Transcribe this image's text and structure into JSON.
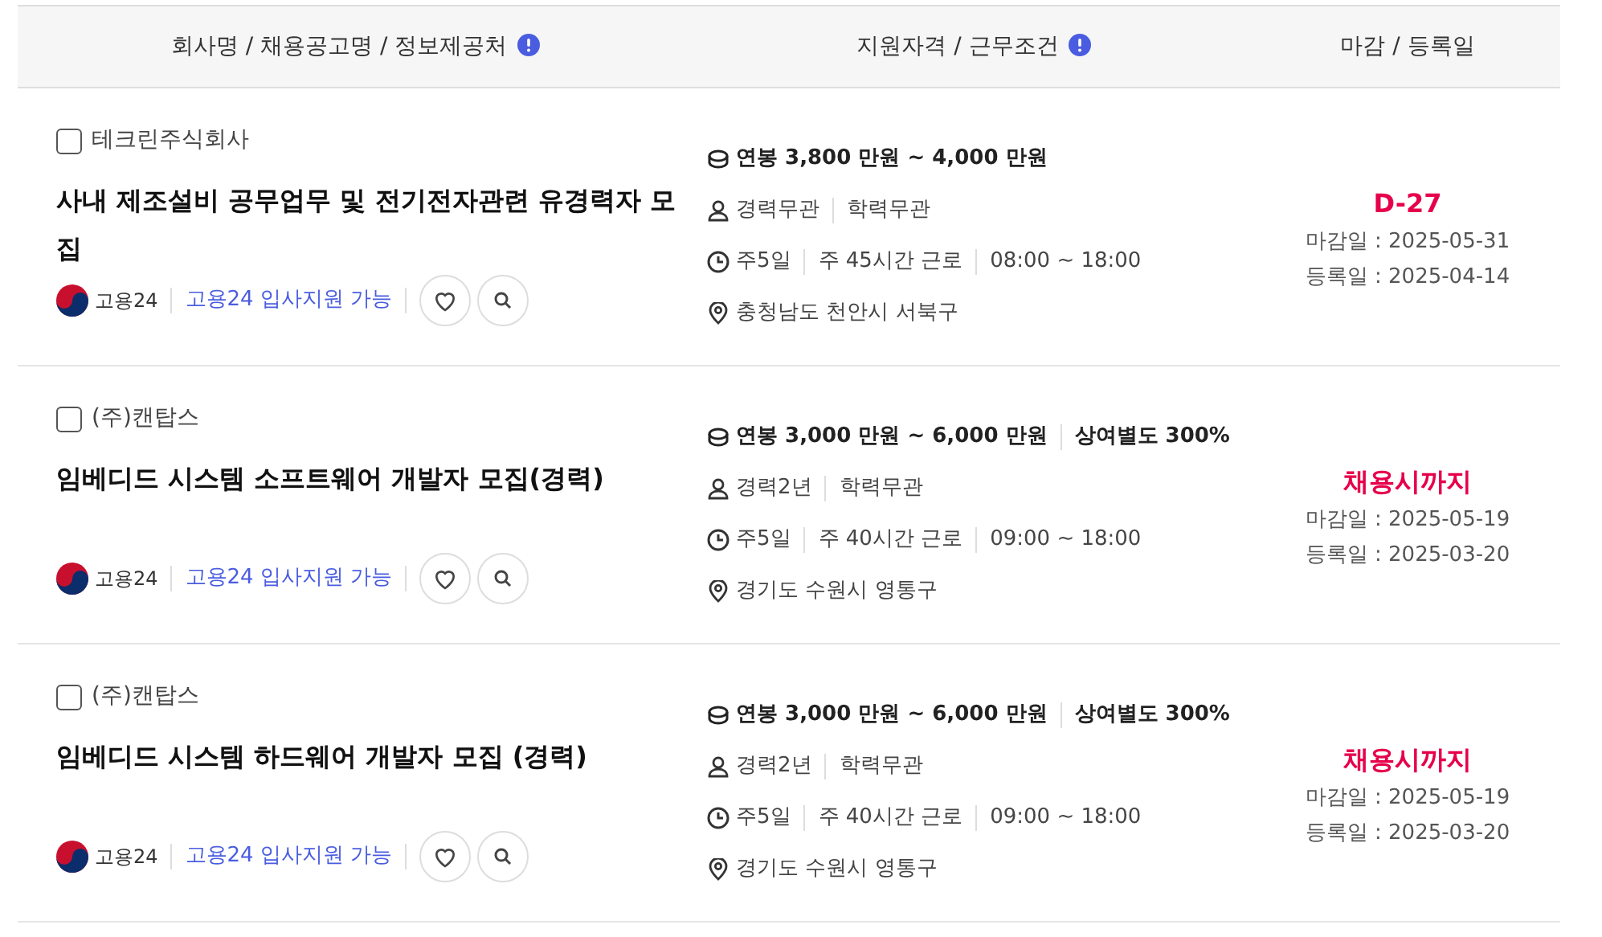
{
  "header": {
    "columns": [
      {
        "label": "회사명 / 채용공고명 / 정보제공처",
        "info": true
      },
      {
        "label": "지원자격 / 근무조건",
        "info": true
      },
      {
        "label": "마감 / 등록일",
        "info": false
      }
    ]
  },
  "jobs": [
    {
      "checked": false,
      "company": "테크린주식회사",
      "title": "사내 제조설비 공무업무 및 전기전자관련 유경력자 모집",
      "source": "고용24",
      "badge": "고용24 입사지원 가능",
      "favorite": false,
      "salary": [
        "연봉 3,800 만원 ~ 4,000 만원"
      ],
      "career": [
        "경력무관",
        "학력무관"
      ],
      "work": [
        "주5일",
        "주 45시간 근로",
        "08:00 ~ 18:00"
      ],
      "location": "충청남도 천안시 서북구",
      "deadline": "D-27",
      "deadline_date": "마감일 : 2025-05-31",
      "registered": "등록일 : 2025-04-14"
    },
    {
      "checked": false,
      "company": "(주)캔탑스",
      "title": "임베디드 시스템 소프트웨어 개발자 모집(경력)",
      "source": "고용24",
      "badge": "고용24 입사지원 가능",
      "favorite": false,
      "salary": [
        "연봉 3,000 만원 ~ 6,000 만원",
        "상여별도 300%"
      ],
      "career": [
        "경력2년",
        "학력무관"
      ],
      "work": [
        "주5일",
        "주 40시간 근로",
        "09:00 ~ 18:00"
      ],
      "location": "경기도 수원시 영통구",
      "deadline": "채용시까지",
      "deadline_date": "마감일 : 2025-05-19",
      "registered": "등록일 : 2025-03-20"
    },
    {
      "checked": false,
      "company": "(주)캔탑스",
      "title": "임베디드 시스템 하드웨어 개발자 모집 (경력)",
      "source": "고용24",
      "badge": "고용24 입사지원 가능",
      "favorite": false,
      "salary": [
        "연봉 3,000 만원 ~ 6,000 만원",
        "상여별도 300%"
      ],
      "career": [
        "경력2년",
        "학력무관"
      ],
      "work": [
        "주5일",
        "주 40시간 근로",
        "09:00 ~ 18:00"
      ],
      "location": "경기도 수원시 영통구",
      "deadline": "채용시까지",
      "deadline_date": "마감일 : 2025-05-19",
      "registered": "등록일 : 2025-03-20"
    }
  ]
}
